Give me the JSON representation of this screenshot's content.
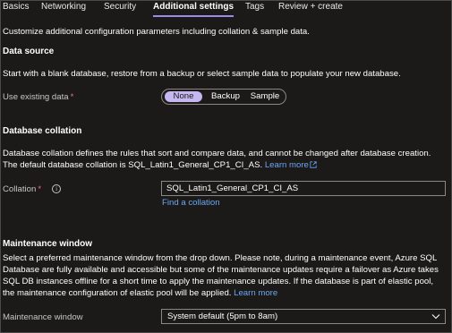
{
  "tabs": [
    {
      "label": "Basics"
    },
    {
      "label": "Networking"
    },
    {
      "label": "Security"
    },
    {
      "label": "Additional settings",
      "active": true
    },
    {
      "label": "Tags"
    },
    {
      "label": "Review + create"
    }
  ],
  "intro": "Customize additional configuration parameters including collation & sample data.",
  "data_source": {
    "heading": "Data source",
    "description": "Start with a blank database, restore from a backup or select sample data to populate your new database.",
    "field_label": "Use existing data",
    "required_mark": "*",
    "options": [
      "None",
      "Backup",
      "Sample"
    ],
    "selected": "None"
  },
  "collation": {
    "heading": "Database collation",
    "description": "Database collation defines the rules that sort and compare data, and cannot be changed after database creation. The default database collation is SQL_Latin1_General_CP1_CI_AS.",
    "learn_more": "Learn more",
    "field_label": "Collation",
    "required_mark": "*",
    "value": "SQL_Latin1_General_CP1_CI_AS",
    "find_link": "Find a collation"
  },
  "maintenance": {
    "heading": "Maintenance window",
    "description": "Select a preferred maintenance window from the drop down. Please note, during a maintenance event, Azure SQL Database are fully available and accessible but some of the maintenance updates require a failover as Azure takes SQL DB instances offline for a short time to apply the maintenance updates. If the database is part of elastic pool, the maintenance configuration of elastic pool will be applied.",
    "learn_more": "Learn more",
    "field_label": "Maintenance window",
    "value": "System default (5pm to 8am)"
  },
  "colors": {
    "background": "#1b1a19",
    "accent": "#9b8ae8",
    "selected_pill": "#c5b7f0",
    "link": "#6aa7f4",
    "required": "#f1707b"
  }
}
